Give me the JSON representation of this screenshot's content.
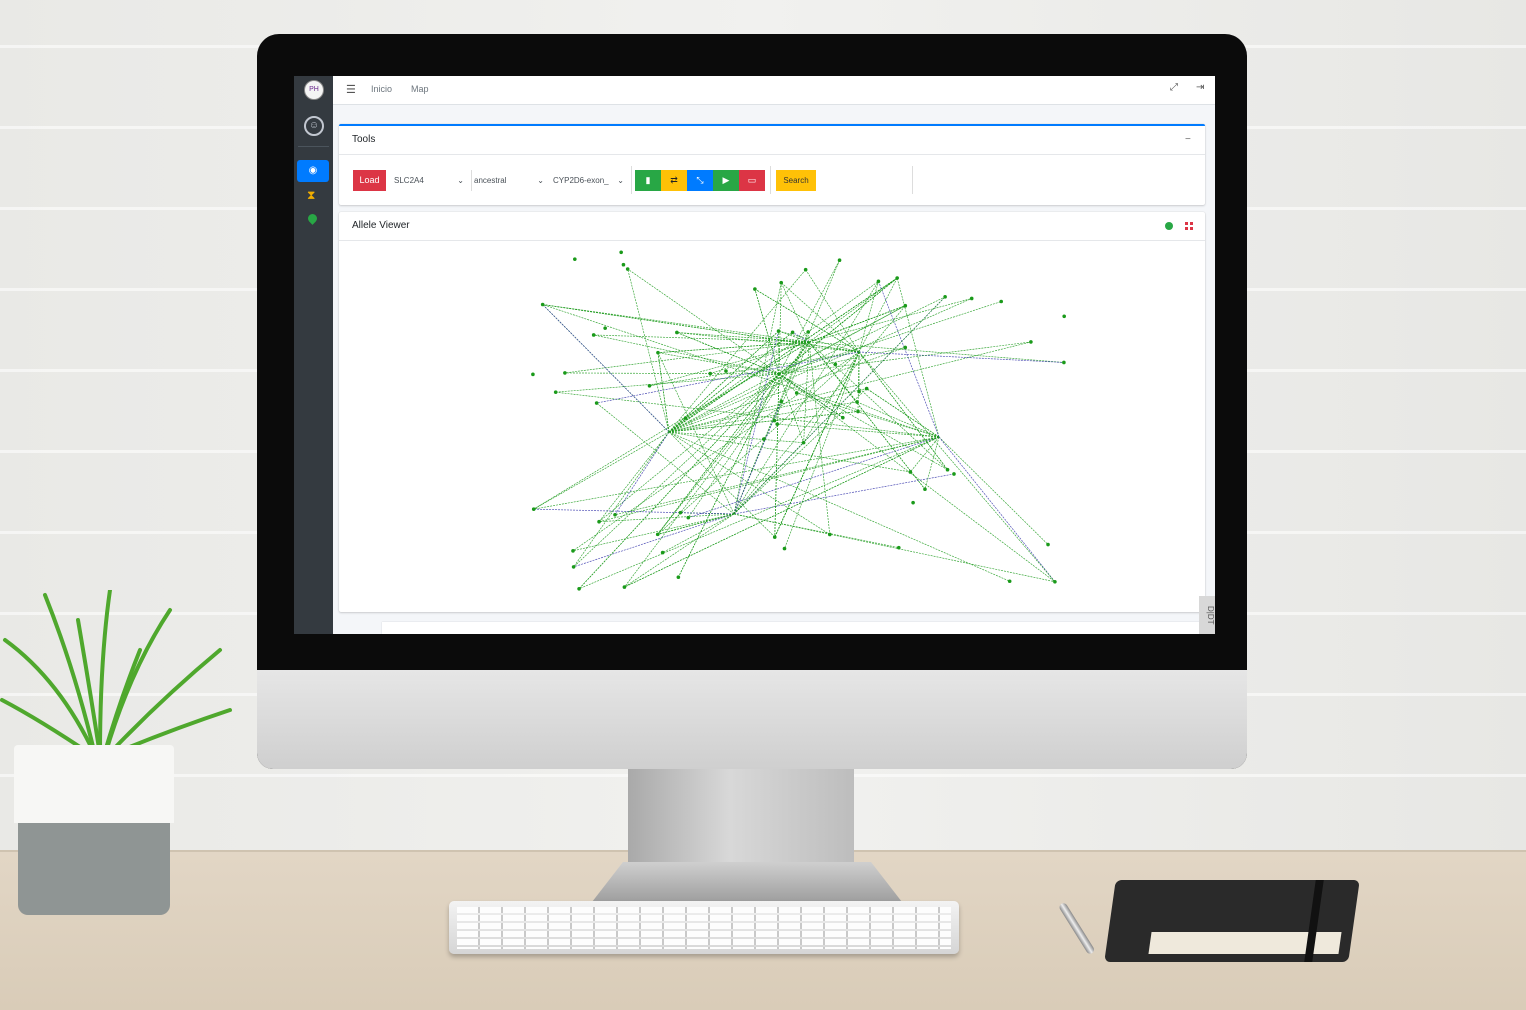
{
  "sidebar": {
    "logo_text": "PH",
    "user_icon": "user-circle-icon",
    "nav": [
      {
        "icon": "dashboard-icon",
        "active": true
      },
      {
        "icon": "hourglass-icon",
        "active": false
      },
      {
        "icon": "map-marker-icon",
        "active": false
      }
    ]
  },
  "topnav": {
    "menu_icon": "hamburger-icon",
    "links": [
      "Inicio",
      "Map"
    ],
    "right_icons": [
      "expand-icon",
      "logout-icon"
    ]
  },
  "tools": {
    "title": "Tools",
    "collapse_label": "−",
    "load_label": "Load",
    "gene_select": "SLC2A4",
    "population_select": "ancestral",
    "allele_select": "CYP2D6-exon_",
    "icon_buttons": [
      {
        "icon": "comment-icon",
        "color": "#28a745"
      },
      {
        "icon": "refresh-icon",
        "color": "#ffc107"
      },
      {
        "icon": "compress-icon",
        "color": "#007bff"
      },
      {
        "icon": "play-icon",
        "color": "#28a745"
      },
      {
        "icon": "vr-icon",
        "color": "#dc3545"
      }
    ],
    "search_label": "Search"
  },
  "viewer": {
    "title": "Allele Viewer",
    "icons": [
      "globe-icon",
      "grid-icon"
    ],
    "edge_color": "#1a9a1a",
    "alt_edge_color": "#3333aa"
  },
  "side_tab_label": "D|DT"
}
